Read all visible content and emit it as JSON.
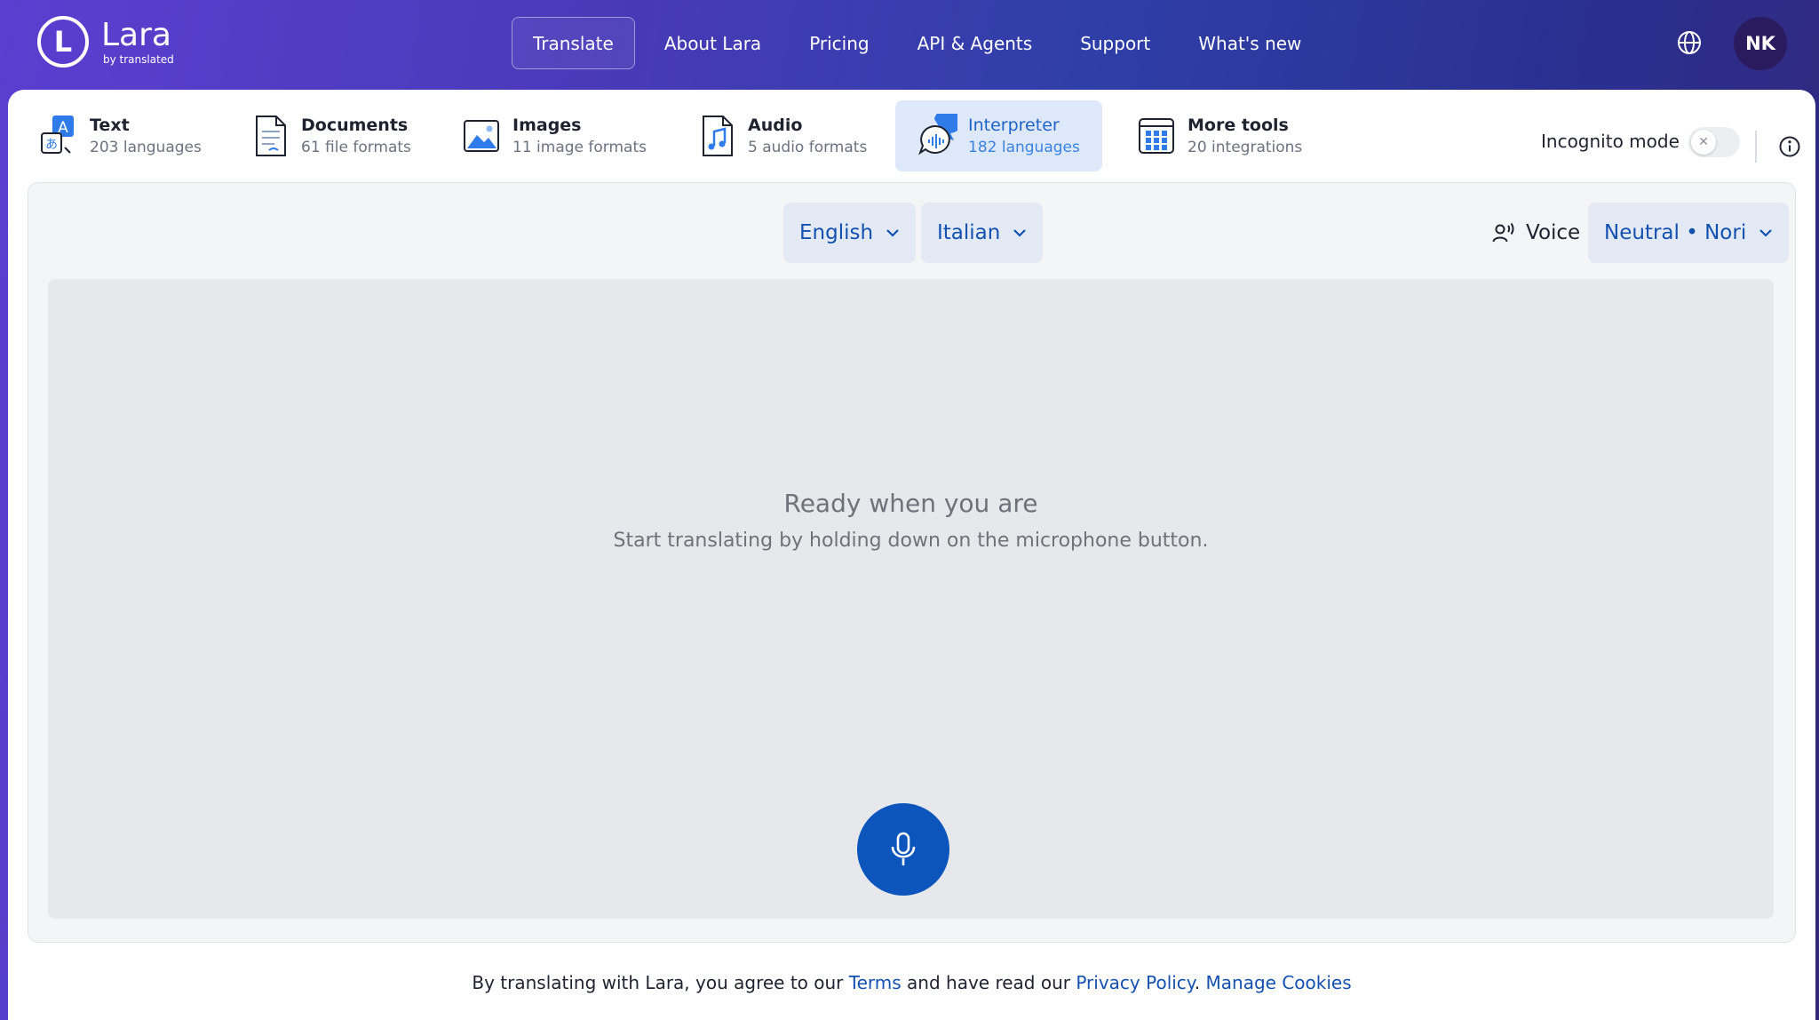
{
  "brand": {
    "name": "Lara",
    "tagline": "by translated",
    "mark": "L"
  },
  "nav": {
    "items": [
      {
        "label": "Translate",
        "active": true
      },
      {
        "label": "About Lara"
      },
      {
        "label": "Pricing"
      },
      {
        "label": "API & Agents"
      },
      {
        "label": "Support"
      },
      {
        "label": "What's new"
      }
    ]
  },
  "user": {
    "initials": "NK"
  },
  "tools": [
    {
      "title": "Text",
      "subtitle": "203 languages",
      "icon": "text-translate-icon"
    },
    {
      "title": "Documents",
      "subtitle": "61 file formats",
      "icon": "document-icon"
    },
    {
      "title": "Images",
      "subtitle": "11 image formats",
      "icon": "image-icon"
    },
    {
      "title": "Audio",
      "subtitle": "5 audio formats",
      "icon": "audio-file-icon"
    },
    {
      "title": "Interpreter",
      "subtitle": "182 languages",
      "icon": "interpreter-icon",
      "active": true
    },
    {
      "title": "More tools",
      "subtitle": "20 integrations",
      "icon": "grid-apps-icon"
    }
  ],
  "incognito": {
    "label": "Incognito mode",
    "enabled": false
  },
  "interpreter": {
    "source_lang": "English",
    "target_lang": "Italian",
    "voice_label": "Voice",
    "voice_value": "Neutral • Nori",
    "ready_title": "Ready when you are",
    "ready_subtitle": "Start translating by holding down on the microphone button."
  },
  "footer": {
    "prefix": "By translating with Lara, you agree to our ",
    "terms": "Terms",
    "middle": " and have read our ",
    "privacy": "Privacy Policy",
    "dot": ". ",
    "cookies": "Manage Cookies"
  },
  "colors": {
    "accent": "#0b55bd",
    "active_tab_bg": "#dde9fb",
    "link": "#1450b0"
  }
}
